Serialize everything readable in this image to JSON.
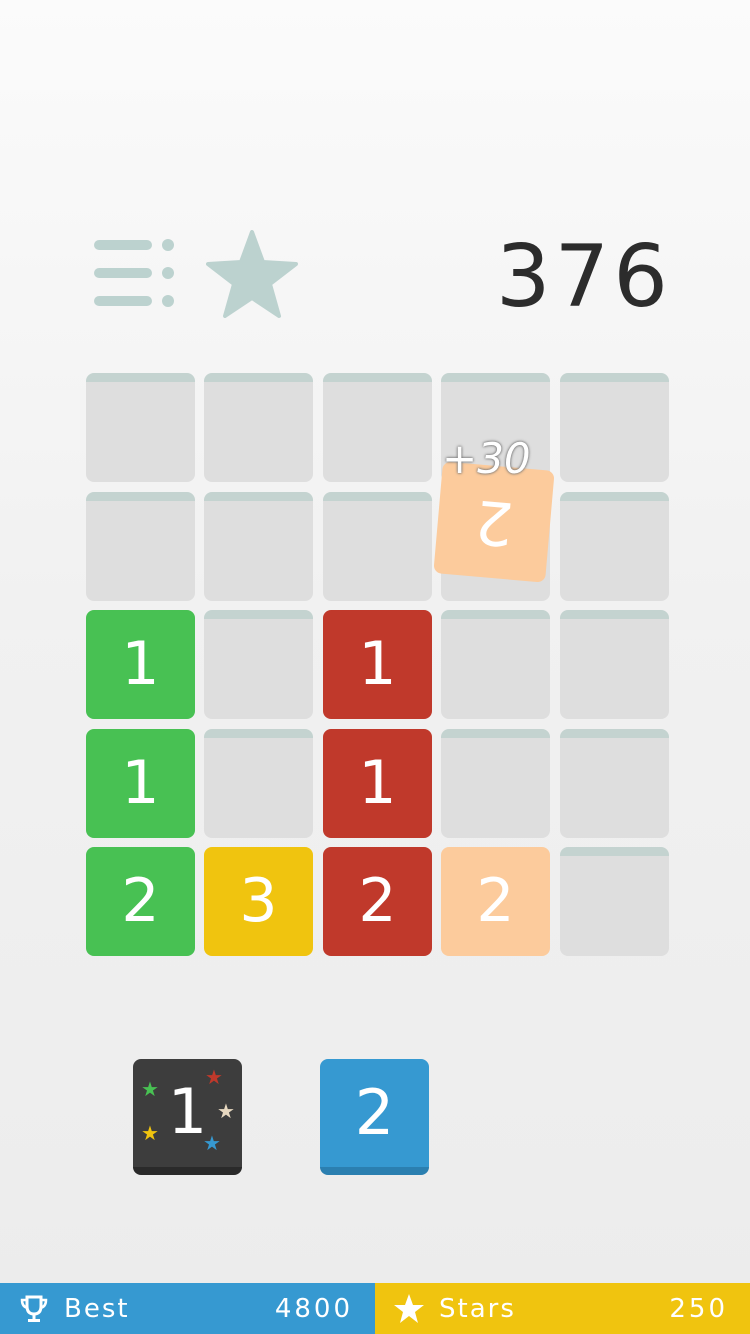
{
  "header": {
    "score": "376",
    "menu_icon": "menu-list-icon",
    "star_icon": "star-icon",
    "icon_color": "#bcd2cf"
  },
  "board": {
    "rows": 5,
    "cols": 5,
    "tiles": [
      {
        "row": 2,
        "col": 0,
        "value": "1",
        "color": "#48c153"
      },
      {
        "row": 2,
        "col": 2,
        "value": "1",
        "color": "#c0392b"
      },
      {
        "row": 3,
        "col": 0,
        "value": "1",
        "color": "#48c153"
      },
      {
        "row": 3,
        "col": 2,
        "value": "1",
        "color": "#c0392b"
      },
      {
        "row": 4,
        "col": 0,
        "value": "2",
        "color": "#48c153"
      },
      {
        "row": 4,
        "col": 1,
        "value": "3",
        "color": "#f0c40f"
      },
      {
        "row": 4,
        "col": 2,
        "value": "2",
        "color": "#c0392b"
      },
      {
        "row": 4,
        "col": 3,
        "value": "2",
        "color": "#fccb9c"
      }
    ],
    "flipping_tile": {
      "row": 1,
      "col": 3,
      "value": "2",
      "color": "#fccb9c"
    },
    "points_popup": "+30"
  },
  "next_tiles": {
    "special": {
      "value": "1",
      "color": "#3d3d3d"
    },
    "regular": {
      "value": "2",
      "color": "#3699d1"
    }
  },
  "footer": {
    "best": {
      "label": "Best",
      "value": "4800",
      "icon": "trophy-icon",
      "color": "#3699d1"
    },
    "stars": {
      "label": "Stars",
      "value": "250",
      "icon": "star-icon",
      "color": "#f0c40f"
    }
  }
}
